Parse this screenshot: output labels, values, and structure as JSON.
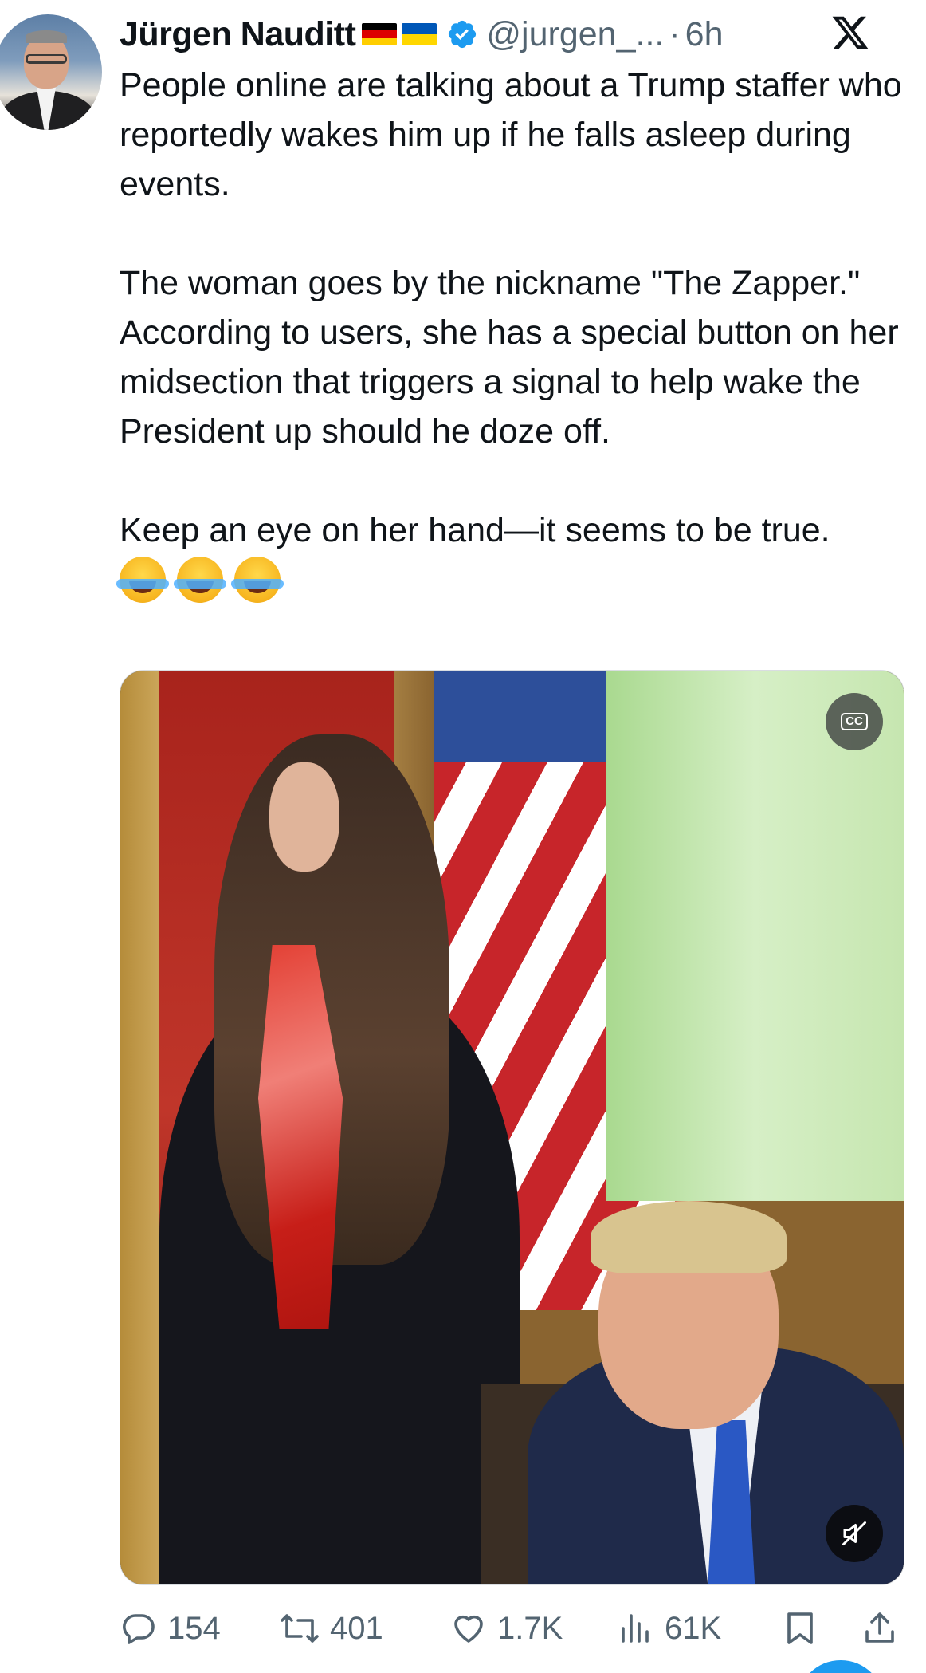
{
  "author": {
    "name": "Jürgen Nauditt",
    "handle": "@jurgen_...",
    "separator": "·",
    "time": "6h",
    "flags": [
      "germany-flag",
      "ukraine-flag"
    ],
    "verified": true
  },
  "tweet": {
    "paragraphs": [
      "People online are talking about a Trump staffer who reportedly wakes him up if he falls asleep during events.",
      "The woman goes by the nickname \"The Zapper.\" According to users, she has a special button on her midsection that triggers a signal to help wake the President up should he doze off.",
      "Keep an eye on her hand—it seems to be true."
    ],
    "emojis": [
      "face-with-tears-of-joy",
      "face-with-tears-of-joy",
      "face-with-tears-of-joy"
    ]
  },
  "media": {
    "type": "video",
    "cc_label": "CC",
    "mute_icon": "muted-speaker-icon"
  },
  "actions": {
    "replies": "154",
    "retweets": "401",
    "likes": "1.7K",
    "views": "61K"
  },
  "colors": {
    "text": "#0f1419",
    "secondary": "#536471",
    "verified_blue": "#1d9bf0"
  }
}
